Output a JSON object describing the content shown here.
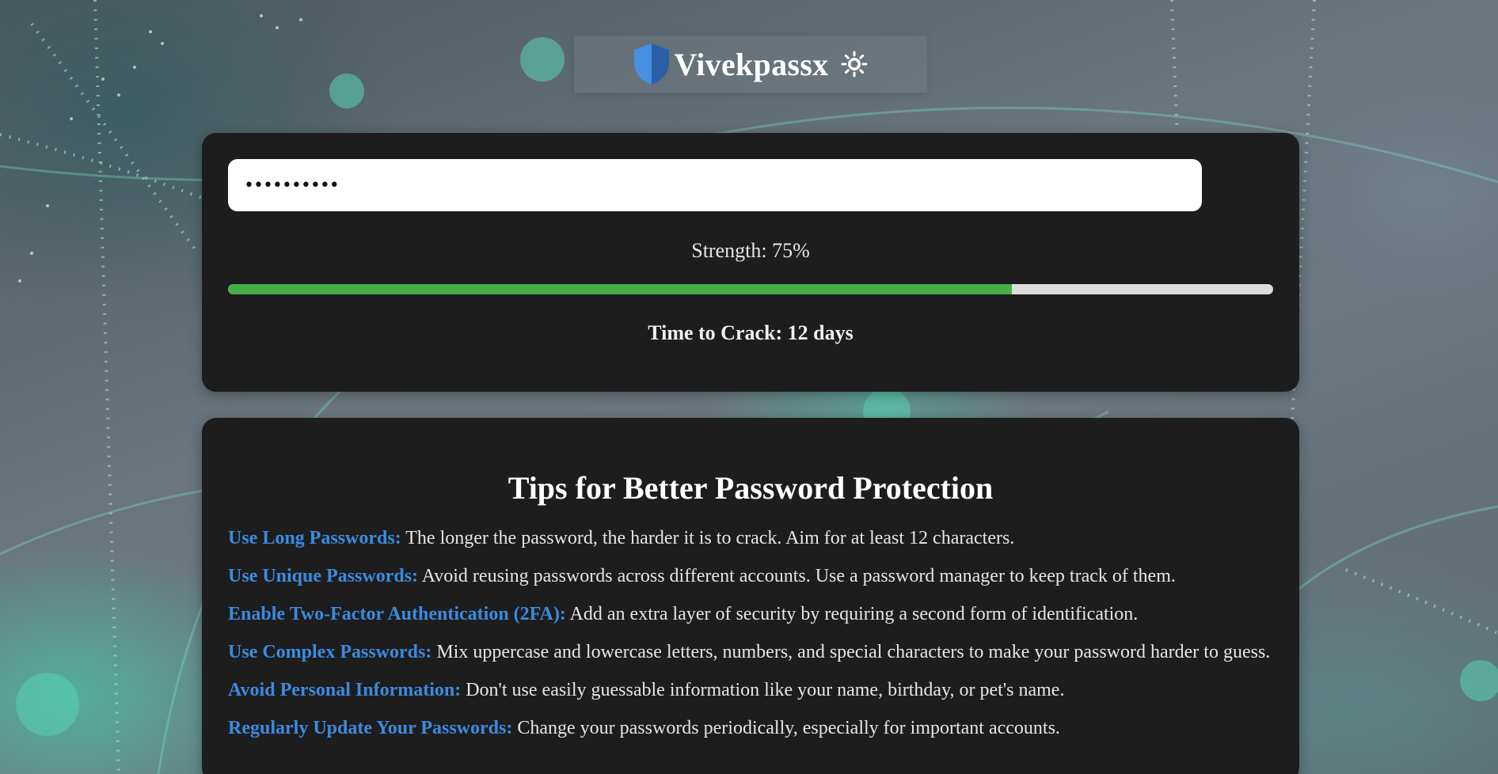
{
  "app": {
    "brand": "Vivekpassx",
    "logo_icon": "shield-icon",
    "theme_toggle_icon": "sun-icon"
  },
  "checker": {
    "password_value": "••••••••••",
    "strength_label": "Strength: 75%",
    "strength_percent": 75,
    "time_to_crack_label": "Time to Crack: 12 days"
  },
  "tips": {
    "title": "Tips for Better Password Protection",
    "items": [
      {
        "heading": "Use Long Passwords:",
        "text": " The longer the password, the harder it is to crack. Aim for at least 12 characters."
      },
      {
        "heading": "Use Unique Passwords:",
        "text": " Avoid reusing passwords across different accounts. Use a password manager to keep track of them."
      },
      {
        "heading": "Enable Two-Factor Authentication (2FA):",
        "text": " Add an extra layer of security by requiring a second form of identification."
      },
      {
        "heading": "Use Complex Passwords:",
        "text": " Mix uppercase and lowercase letters, numbers, and special characters to make your password harder to guess."
      },
      {
        "heading": "Avoid Personal Information:",
        "text": " Don't use easily guessable information like your name, birthday, or pet's name."
      },
      {
        "heading": "Regularly Update Your Passwords:",
        "text": " Change your passwords periodically, especially for important accounts."
      }
    ]
  },
  "colors": {
    "accent": "#3a8be0",
    "strength_fill": "#46ae4a",
    "card_background": "#1d1d1d"
  }
}
